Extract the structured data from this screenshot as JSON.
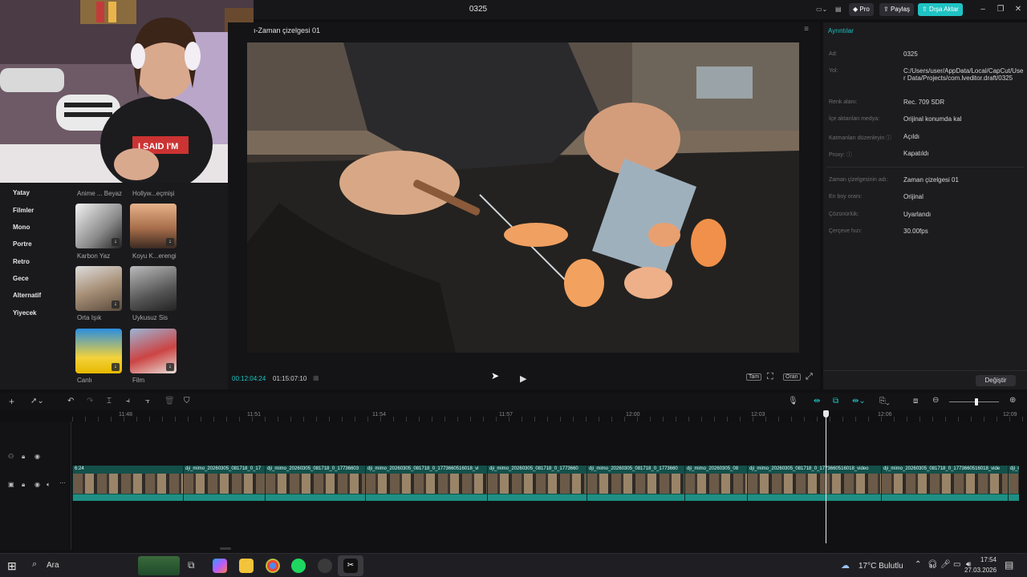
{
  "app": {
    "title": "0325",
    "pro_label": "Pro",
    "share_label": "Paylaş",
    "export_label": "Dışa Aktar",
    "accent": "#1fc3c3"
  },
  "left": {
    "categories": [
      "Yatay",
      "Filmler",
      "Mono",
      "Portre",
      "Retro",
      "Gece",
      "Alternatif",
      "Yiyecek"
    ],
    "top_labels": [
      "Anime ... Beyaz",
      "Hollyw...eçmişi"
    ],
    "filters": [
      {
        "label": "Karbon Yaz"
      },
      {
        "label": "Koyu K...erengi"
      },
      {
        "label": "Orta Işık"
      },
      {
        "label": "Uykusuz Sis"
      },
      {
        "label": "Canlı"
      },
      {
        "label": "Film"
      }
    ]
  },
  "player": {
    "header": "ı-Zaman çizelgesi 01",
    "current_time": "00:12:04:24",
    "total_time": "01:15:07:10",
    "btn_full": "Tam",
    "btn_ratio": "Oran"
  },
  "details": {
    "tab": "Ayrıntılar",
    "rows": [
      {
        "label": "Ad:",
        "value": "0325"
      },
      {
        "label": "Yol:",
        "value": "C:/Users/user/AppData/Local/CapCut/User Data/Projects/com.lveditor.draft/0325"
      },
      {
        "label": "Renk alanı:",
        "value": "Rec. 709 SDR"
      },
      {
        "label": "İçe aktarılan medya:",
        "value": "Orijinal konumda kal"
      },
      {
        "label": "Katmanları düzenleyin ⓘ",
        "value": "Açıldı"
      },
      {
        "label": "Proxy: ⓘ",
        "value": "Kapatıldı"
      },
      {
        "label": "Zaman çizelgesinin adı:",
        "value": "Zaman çizelgesi 01"
      },
      {
        "label": "En boy oranı:",
        "value": "Orijinal"
      },
      {
        "label": "Çözünürlük:",
        "value": "Uyarlandı"
      },
      {
        "label": "Çerçeve hızı:",
        "value": "30.00fps"
      }
    ],
    "change_button": "Değiştir"
  },
  "timeline": {
    "ruler": [
      "11:48",
      "11:51",
      "11:54",
      "11:57",
      "12:00",
      "12:03",
      "12:06",
      "12:09"
    ],
    "first_clip": "6:24",
    "clips": [
      "dji_mimo_20260305_081718_0_17",
      "dji_mimo_20260305_081718_0_17736603",
      "dji_mimo_20260305_081718_0_1773660516018_vi",
      "dji_mimo_20260305_081718_0_1773660",
      "dji_mimo_20260305_081718_0_1773660",
      "dji_mimo_20260305_08",
      "dji_mimo_20260305_081718_0_1773660516018_video",
      "dji_mimo_20260305_081718_0_1773660516018_vide",
      "dji_mi"
    ]
  },
  "taskbar": {
    "search": "Ara",
    "weather": "17°C  Bulutlu",
    "time": "17:54",
    "date": "27.03.2026"
  }
}
